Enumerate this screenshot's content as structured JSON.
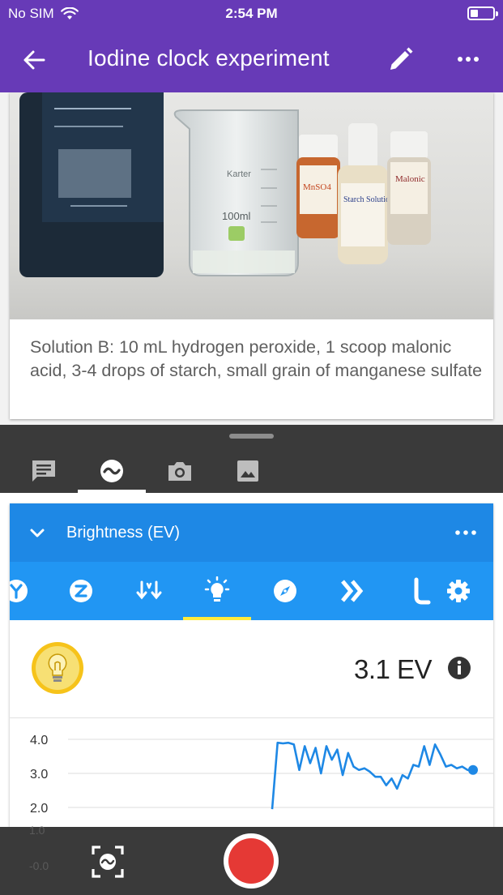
{
  "status_bar": {
    "carrier": "No SIM",
    "time": "2:54 PM"
  },
  "app_bar": {
    "title": "Iodine clock experiment"
  },
  "note": {
    "photo_labels": {
      "beaker_brand": "Karter",
      "beaker_volume": "100ml",
      "bottle_1": "MnSO4",
      "bottle_2": "Starch Solution",
      "bottle_3": "Malonic",
      "bottle_2_label": "Starch Solution"
    },
    "caption": "Solution B: 10 mL hydrogen peroxide, 1 scoop malonic acid, 3-4 drops of starch, small grain of manganese sulfate"
  },
  "tool_tabs": [
    {
      "icon": "note-icon"
    },
    {
      "icon": "sensor-icon",
      "active": true
    },
    {
      "icon": "camera-icon"
    },
    {
      "icon": "gallery-icon"
    }
  ],
  "sensor": {
    "name": "Brightness (EV)",
    "value": "3.1 EV",
    "tabs": [
      "accel-y-icon",
      "accel-z-icon",
      "linear-accel-icon",
      "brightness-icon",
      "compass-icon",
      "magnetometer-icon",
      "pitch-icon",
      "settings-icon"
    ],
    "active_tab": "brightness-icon"
  },
  "chart_data": {
    "type": "line",
    "ylim": [
      -0.2,
      4.4
    ],
    "yticks": [
      "4.0",
      "3.0",
      "2.0",
      "1.0",
      "-0.0"
    ],
    "series": [
      {
        "values": [
          1.95,
          3.9,
          3.88,
          3.9,
          3.85,
          3.1,
          3.8,
          3.3,
          3.75,
          3.0,
          3.8,
          3.4,
          3.7,
          2.95,
          3.6,
          3.2,
          3.1,
          3.15,
          3.05,
          2.9,
          2.9,
          2.65,
          2.85,
          2.55,
          2.95,
          2.85,
          3.25,
          3.2,
          3.8,
          3.25,
          3.85,
          3.55,
          3.2,
          3.25,
          3.15,
          3.2,
          3.1,
          3.1
        ]
      }
    ],
    "colors": {
      "line": "#1e88e5",
      "grid": "#dedede"
    }
  },
  "bottom_bar": {
    "ghost_ticks": [
      "1.0",
      "-0.0"
    ]
  },
  "colors": {
    "header": "#673ab7",
    "sensor_header": "#1e88e5",
    "sensor_tabs": "#2196f3",
    "record": "#e53935",
    "tab_indicator": "#ffeb3b"
  }
}
